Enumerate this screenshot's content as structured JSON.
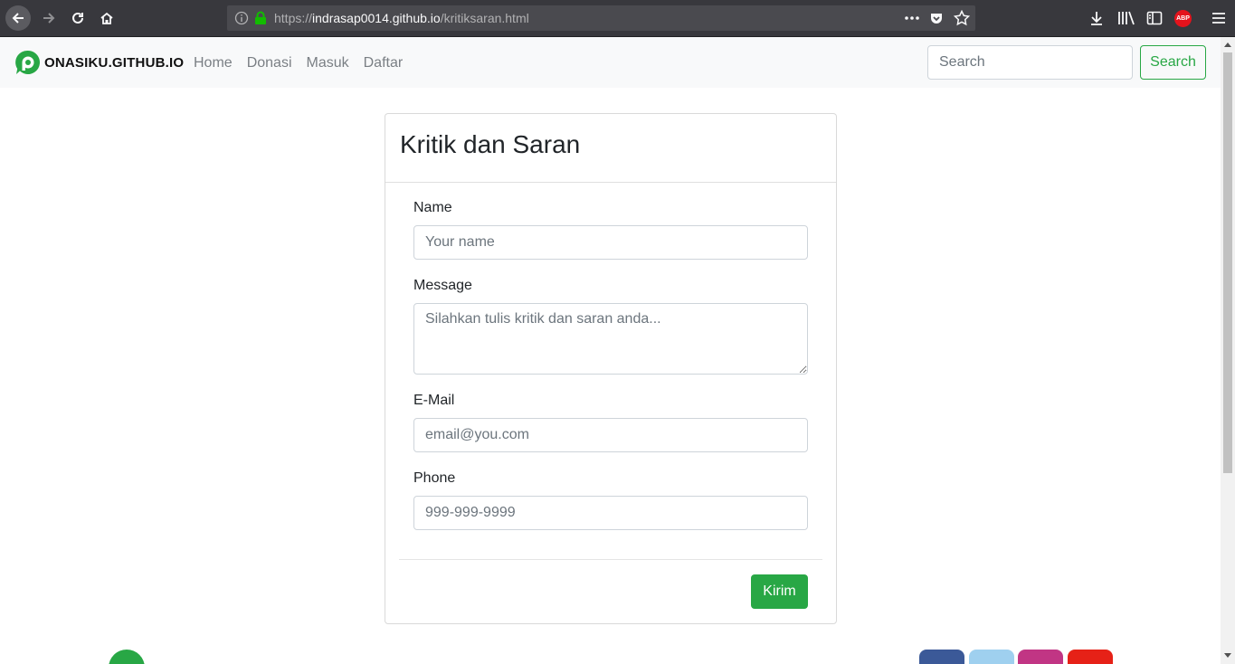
{
  "browser": {
    "url_prefix": "https://",
    "url_host": "indrasap0014.github.io",
    "url_path": "/kritiksaran.html",
    "adblock_label": "ABP"
  },
  "navbar": {
    "brand": "ONASIKU.GITHUB.IO",
    "links": [
      "Home",
      "Donasi",
      "Masuk",
      "Daftar"
    ],
    "search_placeholder": "Search",
    "search_button": "Search"
  },
  "form": {
    "title": "Kritik dan Saran",
    "name_label": "Name",
    "name_placeholder": "Your name",
    "message_label": "Message",
    "message_placeholder": "Silahkan tulis kritik dan saran anda...",
    "email_label": "E-Mail",
    "email_placeholder": "email@you.com",
    "phone_label": "Phone",
    "phone_placeholder": "999-999-9999",
    "submit_label": "Kirim"
  },
  "colors": {
    "accent": "#28a745",
    "chrome_bg": "#38383d",
    "navbar_bg": "#f8f9fa"
  },
  "footer": {
    "social_icons": [
      "facebook-icon",
      "twitter-icon",
      "instagram-icon",
      "youtube-icon"
    ]
  }
}
